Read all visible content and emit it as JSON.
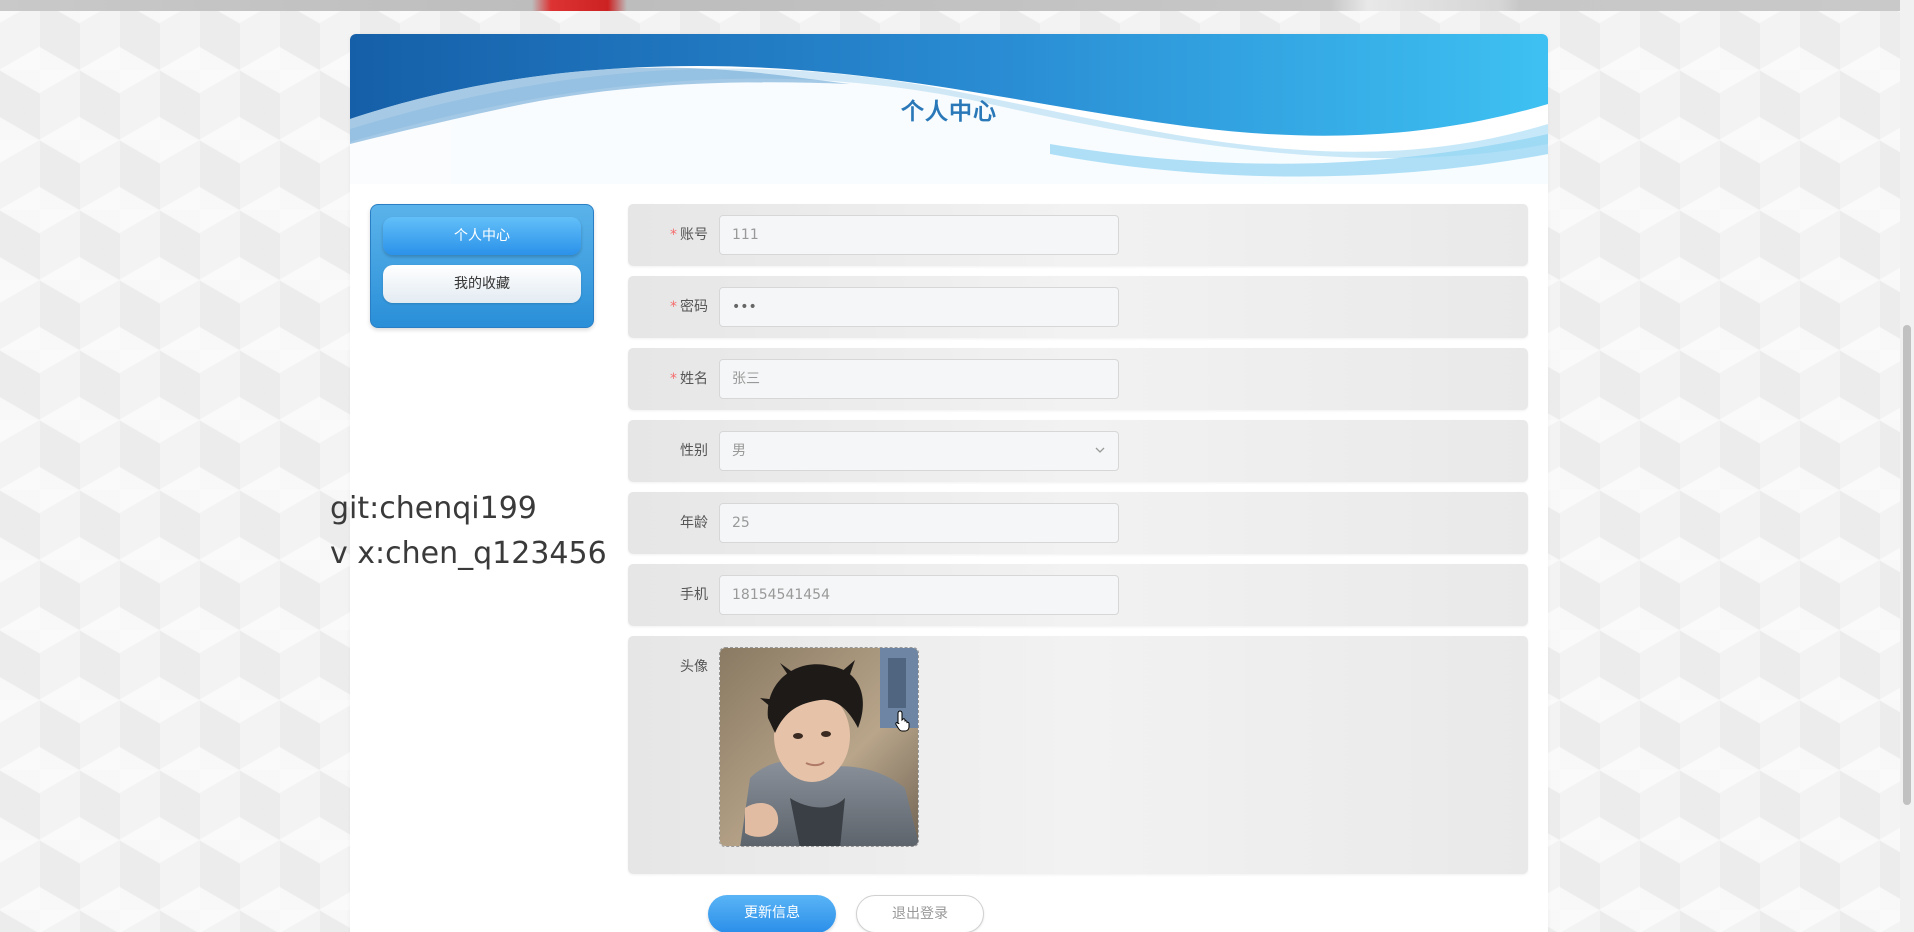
{
  "page": {
    "title": "个人中心"
  },
  "sidebar": {
    "items": [
      {
        "label": "个人中心",
        "active": true
      },
      {
        "label": "我的收藏",
        "active": false
      }
    ]
  },
  "watermark": {
    "line1": "git:chenqi199",
    "line2": "v x:chen_q123456"
  },
  "form": {
    "account": {
      "label": "账号",
      "value": "111",
      "required": true
    },
    "password": {
      "label": "密码",
      "value": "•••",
      "required": true
    },
    "name": {
      "label": "姓名",
      "value": "张三",
      "required": true
    },
    "gender": {
      "label": "性别",
      "value": "男",
      "required": false
    },
    "age": {
      "label": "年龄",
      "value": "25",
      "required": false
    },
    "phone": {
      "label": "手机",
      "value": "18154541454",
      "required": false
    },
    "avatar": {
      "label": "头像",
      "required": false
    },
    "required_mark": "*"
  },
  "buttons": {
    "update": "更新信息",
    "logout": "退出登录"
  },
  "colors": {
    "accent": "#2a8fd8",
    "title": "#2a78b8",
    "required": "#f56c6c"
  }
}
